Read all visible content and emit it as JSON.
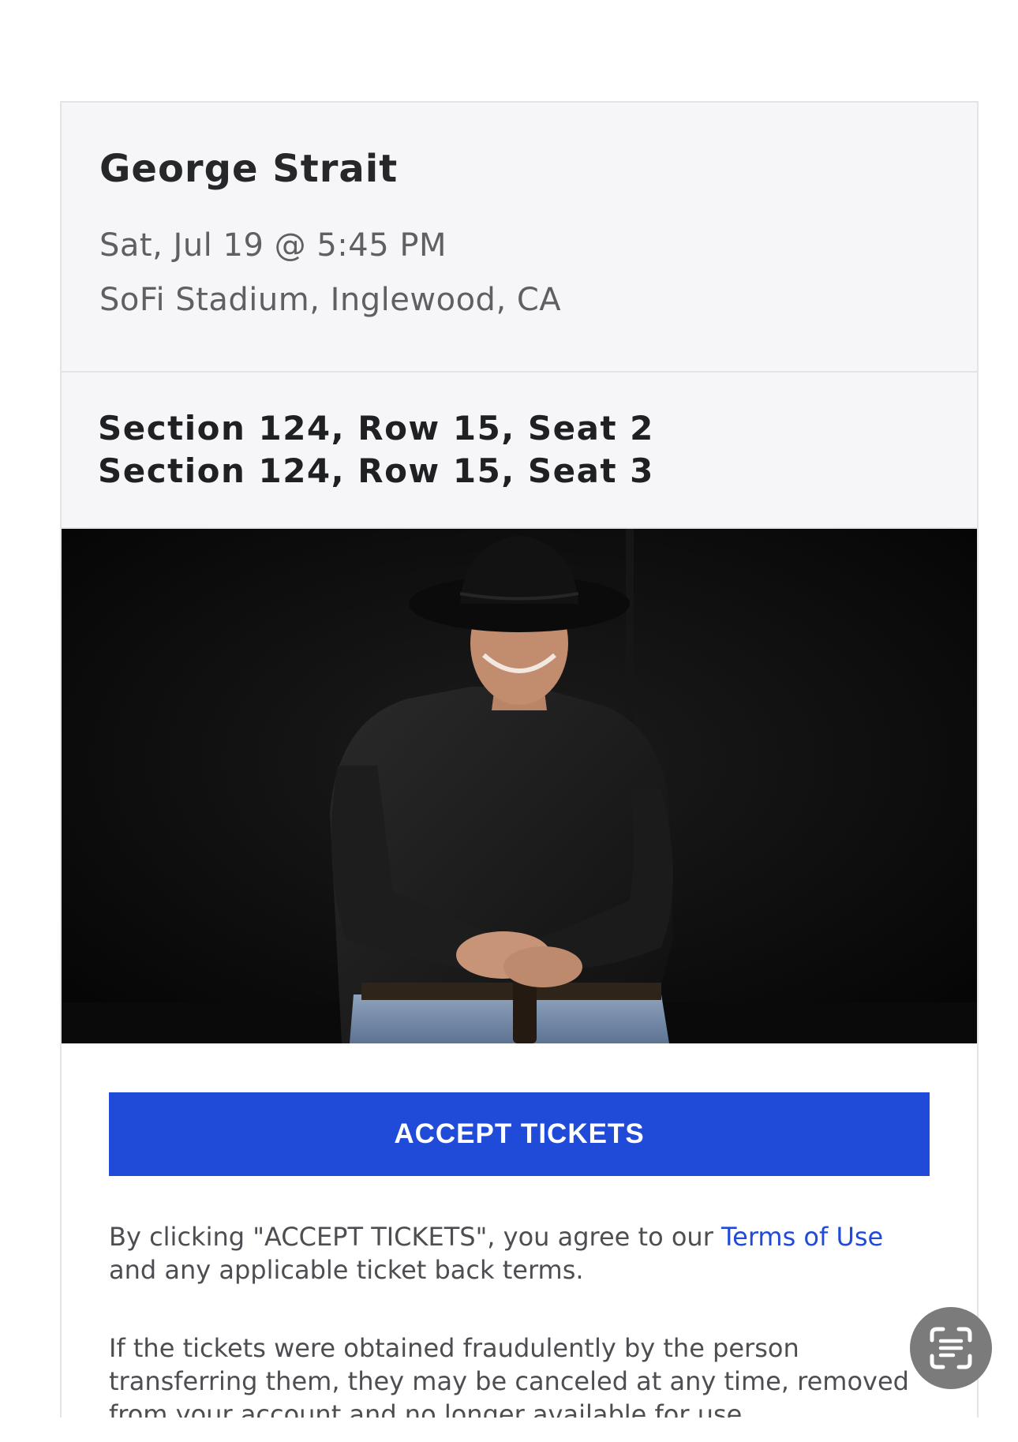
{
  "event": {
    "title": "George Strait",
    "date": "Sat, Jul 19 @ 5:45 PM",
    "venue": "SoFi Stadium, Inglewood, CA"
  },
  "seats": [
    "Section 124, Row 15, Seat 2",
    "Section 124, Row 15, Seat 3"
  ],
  "accept_button": {
    "label": "ACCEPT TICKETS",
    "color": "#1f4bd8"
  },
  "terms": {
    "prefix": "By clicking \"ACCEPT TICKETS\", you agree to our ",
    "link_text": "Terms of Use",
    "suffix": " and any applicable ticket back terms."
  },
  "fraud_notice": "If the tickets were obtained fraudulently by the person transferring them, they may be canceled at any time, removed from your account and no longer available for use.",
  "floating_button": {
    "icon": "live-text-scan-icon"
  }
}
